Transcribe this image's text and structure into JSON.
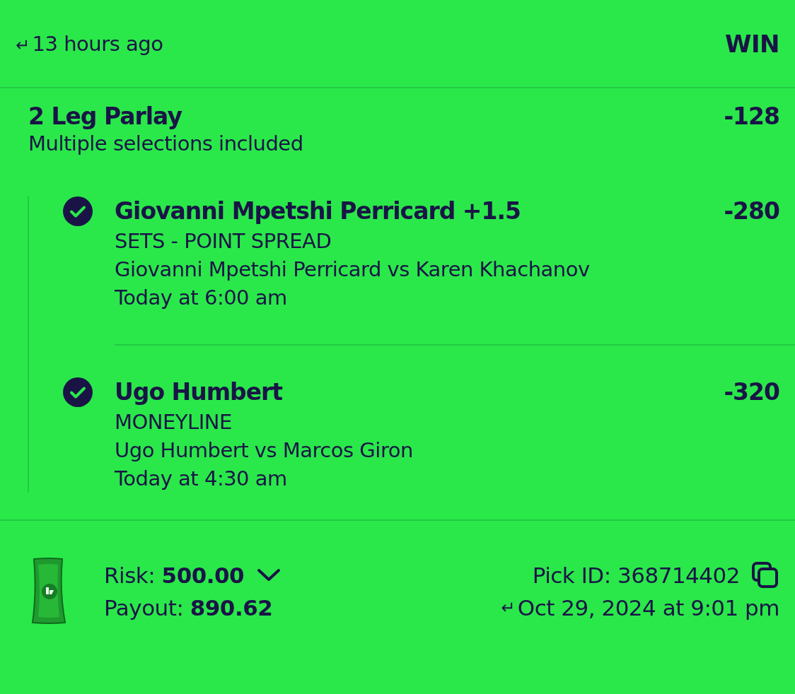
{
  "header": {
    "back_glyph": "↵",
    "time": "13 hours ago",
    "result": "WIN"
  },
  "bet": {
    "title": "2 Leg Parlay",
    "subtitle": "Multiple selections included",
    "odds": "-128"
  },
  "legs": [
    {
      "won": true,
      "selection": "Giovanni Mpetshi Perricard +1.5",
      "odds": "-280",
      "market": "SETS - POINT SPREAD",
      "matchup": "Giovanni Mpetshi Perricard vs Karen Khachanov",
      "time": "Today at 6:00 am"
    },
    {
      "won": true,
      "selection": "Ugo Humbert",
      "odds": "-320",
      "market": "MONEYLINE",
      "matchup": "Ugo Humbert vs Marcos Giron",
      "time": "Today at 4:30 am"
    }
  ],
  "footer": {
    "risk": "Risk: **500.00**",
    "payout": "Payout: **890.62**",
    "pick_id": "Pick ID: 368714402",
    "placed_glyph": "↵",
    "placed": "Oct 29, 2024 at 9:01 pm"
  }
}
